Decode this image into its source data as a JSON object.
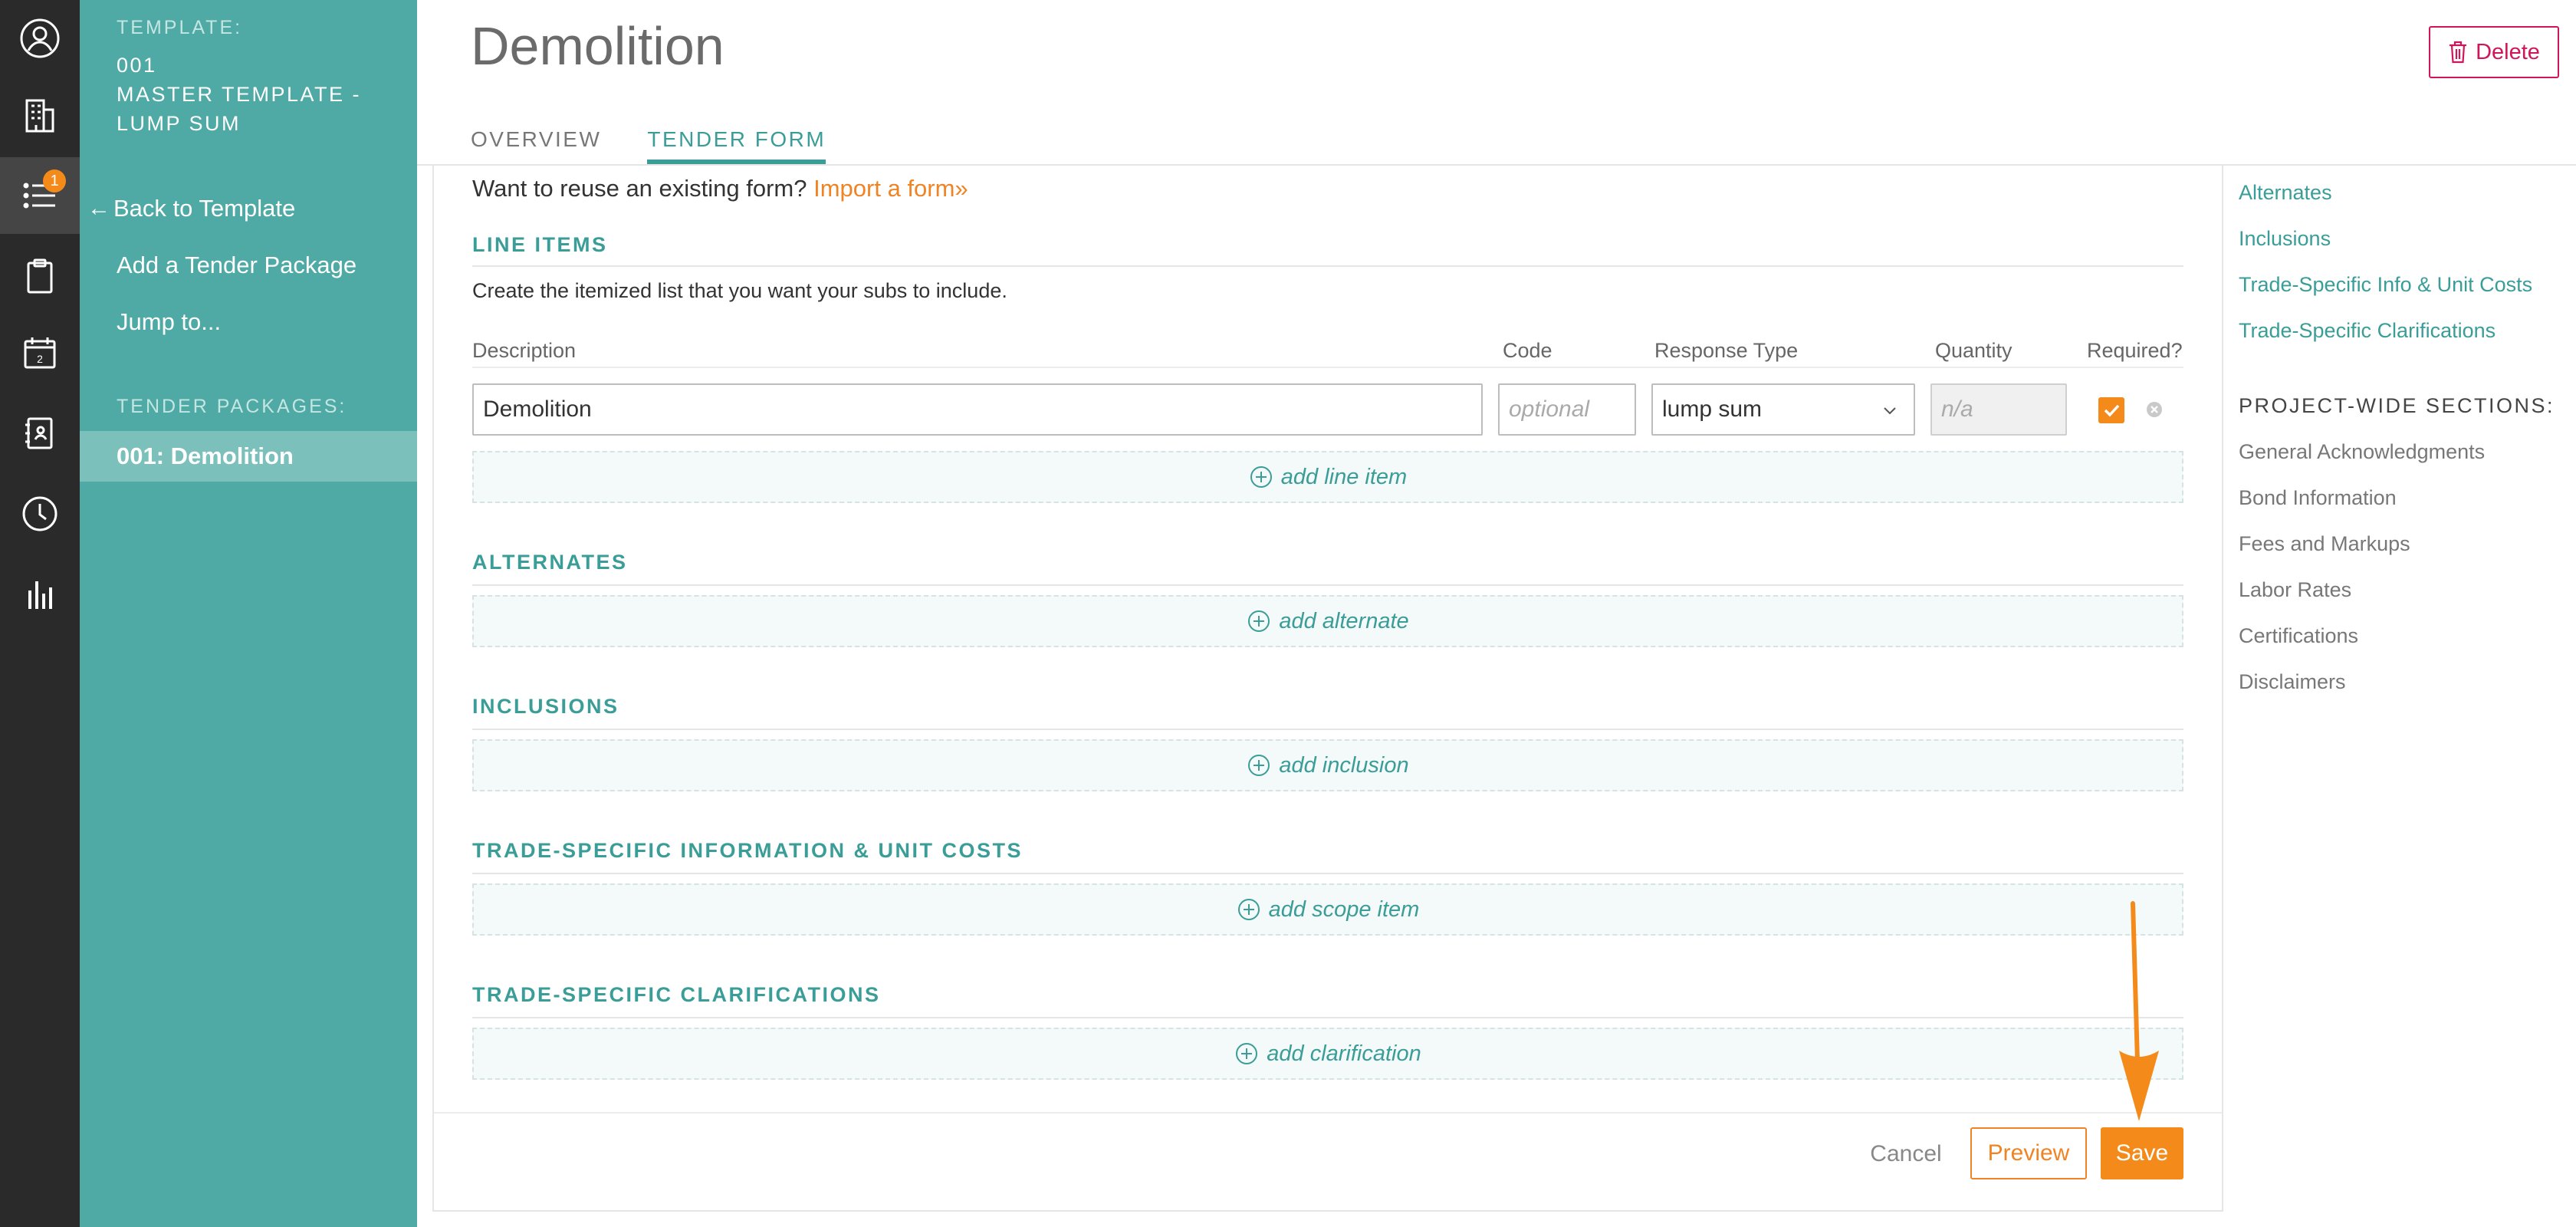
{
  "rail": {
    "badge_count": "1",
    "icons": [
      "user-circle-icon",
      "building-icon",
      "list-icon",
      "clipboard-icon",
      "calendar-icon",
      "contact-book-icon",
      "clock-icon",
      "bar-chart-icon"
    ]
  },
  "nav": {
    "template_label": "TEMPLATE:",
    "template_lines": [
      "001",
      "MASTER TEMPLATE -",
      "LUMP SUM"
    ],
    "back": "Back to Template",
    "add_package": "Add a Tender Package",
    "jump_to": "Jump to...",
    "packages_label": "TENDER PACKAGES:",
    "active_package": "001: Demolition"
  },
  "header": {
    "title": "Demolition",
    "delete": "Delete",
    "tabs": [
      {
        "label": "OVERVIEW",
        "active": false
      },
      {
        "label": "TENDER FORM",
        "active": true
      }
    ]
  },
  "form": {
    "reuse_text": "Want to reuse an existing form?",
    "import_link": "Import a form»",
    "line_items": {
      "heading": "LINE ITEMS",
      "instructions": "Create the itemized list that you want your subs to include.",
      "columns": {
        "description": "Description",
        "code": "Code",
        "response_type": "Response Type",
        "quantity": "Quantity",
        "required": "Required?"
      },
      "row": {
        "description": "Demolition",
        "code_placeholder": "optional",
        "response_type": "lump sum",
        "quantity_placeholder": "n/a",
        "required": true
      },
      "add": "add line item"
    },
    "alternates": {
      "heading": "ALTERNATES",
      "add": "add alternate"
    },
    "inclusions": {
      "heading": "INCLUSIONS",
      "add": "add inclusion"
    },
    "trade_info": {
      "heading": "TRADE-SPECIFIC INFORMATION & UNIT COSTS",
      "add": "add scope item"
    },
    "clarifications": {
      "heading": "TRADE-SPECIFIC CLARIFICATIONS",
      "add": "add clarification"
    }
  },
  "footer": {
    "cancel": "Cancel",
    "preview": "Preview",
    "save": "Save"
  },
  "sidebar": {
    "links": [
      "Alternates",
      "Inclusions",
      "Trade-Specific Info & Unit Costs",
      "Trade-Specific Clarifications"
    ],
    "project_heading": "PROJECT-WIDE SECTIONS:",
    "project_items": [
      "General Acknowledgments",
      "Bond Information",
      "Fees and Markups",
      "Labor Rates",
      "Certifications",
      "Disclaimers"
    ]
  },
  "colors": {
    "teal": "#4fa9a4",
    "teal_text": "#3a9d97",
    "orange": "#f48a1a",
    "delete_red": "#d0155a",
    "rail": "#2a2a2a"
  }
}
